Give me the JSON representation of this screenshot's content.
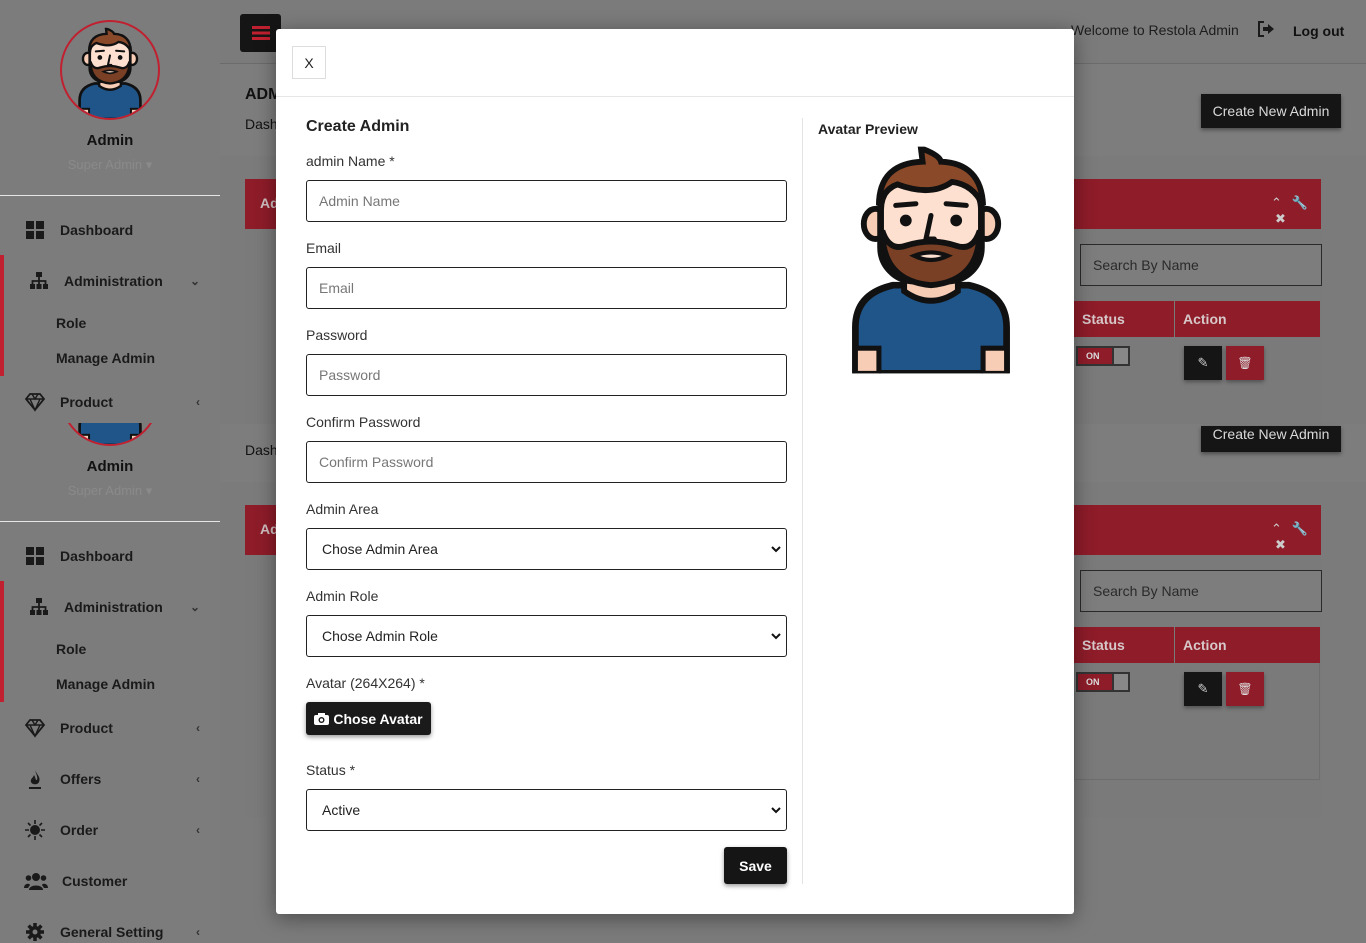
{
  "sidebar": {
    "user_name": "Admin",
    "user_role": "Super Admin ▾",
    "items": [
      {
        "label": "Dashboard",
        "icon": "grid-icon"
      },
      {
        "label": "Administration",
        "icon": "sitemap-icon"
      },
      {
        "label": "Product",
        "icon": "diamond-icon"
      },
      {
        "label": "Offers",
        "icon": "fire-icon"
      },
      {
        "label": "Order",
        "icon": "sun-icon"
      },
      {
        "label": "Customer",
        "icon": "users-icon"
      },
      {
        "label": "General Setting",
        "icon": "gear-icon"
      }
    ],
    "sub_items": [
      "Role",
      "Manage Admin"
    ]
  },
  "header": {
    "welcome": "Welcome to Restola Admin",
    "logout": "Log out"
  },
  "page": {
    "title": "ADM",
    "breadcrumb": "Dash",
    "create_button": "Create New Admin",
    "panel_title": "Ad",
    "search_placeholder": "Search By Name",
    "columns": {
      "status": "Status",
      "action": "Action"
    },
    "status_toggle": "ON"
  },
  "modal": {
    "close": "X",
    "title": "Create Admin",
    "admin_name_label": "admin Name *",
    "admin_name_placeholder": "Admin Name",
    "email_label": "Email",
    "email_placeholder": "Email",
    "password_label": "Password",
    "password_placeholder": "Password",
    "confirm_label": "Confirm Password",
    "confirm_placeholder": "Confirm Password",
    "area_label": "Admin Area",
    "area_value": "Chose Admin Area",
    "role_label": "Admin Role",
    "role_value": "Chose Admin Role",
    "avatar_label": "Avatar (264X264) *",
    "avatar_button": "Chose Avatar",
    "status_label": "Status *",
    "status_value": "Active",
    "save": "Save",
    "preview_title": "Avatar Preview"
  },
  "colors": {
    "accent": "#c0202f",
    "dark": "#151515"
  }
}
